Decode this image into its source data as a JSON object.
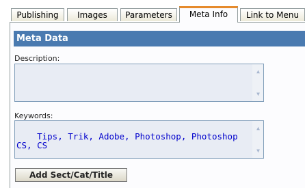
{
  "tabs": [
    {
      "label": "Publishing",
      "active": false
    },
    {
      "label": "Images",
      "active": false
    },
    {
      "label": "Parameters",
      "active": false
    },
    {
      "label": "Meta Info",
      "active": true
    },
    {
      "label": "Link to Menu",
      "active": false
    }
  ],
  "section": {
    "title": "Meta Data"
  },
  "fields": {
    "description_label": "Description:",
    "description_value": "",
    "keywords_label": "Keywords:",
    "keywords_value": "Tips, Trik, Adobe, Photoshop, Photoshop CS, CS"
  },
  "buttons": {
    "add_label": "Add Sect/Cat/Title"
  },
  "colors": {
    "header_bg": "#4a7ab0",
    "active_tab_accent": "#e68b2c",
    "keywords_text": "#0000cc"
  }
}
